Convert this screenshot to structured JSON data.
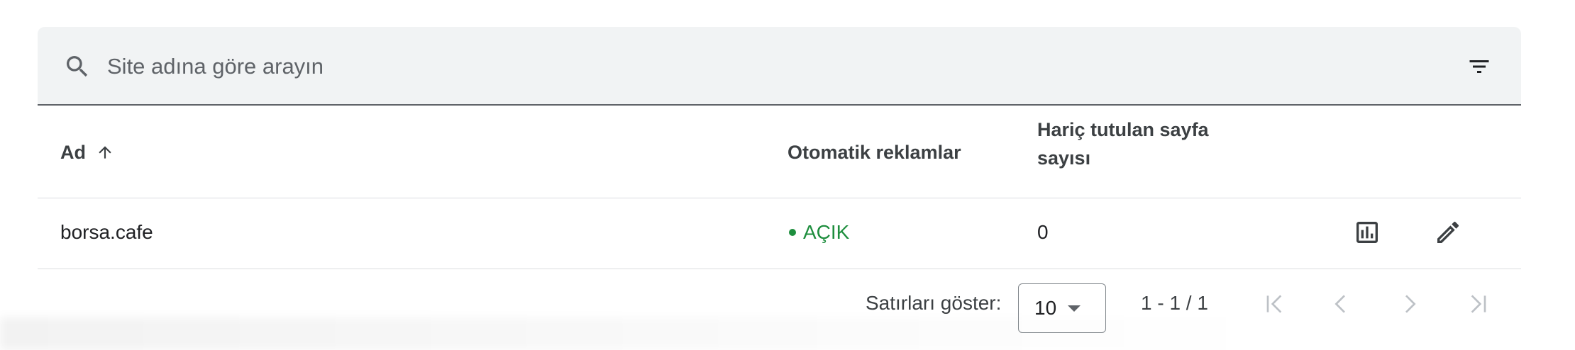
{
  "search": {
    "placeholder": "Site adına göre arayın"
  },
  "table": {
    "columns": {
      "name": "Ad",
      "auto_ads": "Otomatik reklamlar",
      "excluded_pages": "Hariç tutulan sayfa sayısı"
    },
    "rows": [
      {
        "name": "borsa.cafe",
        "auto_ads": "AÇIK",
        "excluded_pages": "0"
      }
    ]
  },
  "pagination": {
    "rows_label": "Satırları göster:",
    "rows_per_page": "10",
    "range": "1 - 1 / 1"
  },
  "colors": {
    "status_on": "#1e8e3e",
    "search_bg": "#f1f3f4",
    "icon": "#5f6368"
  },
  "icons": [
    "search-icon",
    "filter-icon",
    "sort-arrow-up-icon",
    "bar-chart-icon",
    "edit-pencil-icon",
    "first-page-icon",
    "chevron-left-icon",
    "chevron-right-icon",
    "last-page-icon",
    "dropdown-caret-icon"
  ]
}
